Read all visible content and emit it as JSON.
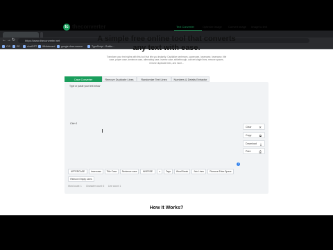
{
  "browser": {
    "url": "https://www.theconverter.net",
    "bookmarks": [
      "CIS",
      "EE",
      "chatGPT",
      "Whiteboard",
      "google docs source",
      "TypeScript - Builde..."
    ]
  },
  "site": {
    "logo_text": "theconverter",
    "logo_letter": "tc",
    "nav": [
      "Text Converter",
      "Optimize image",
      "Convert image",
      "Image to text"
    ],
    "hero_title": "A simple free online tool that converts any text with ease.",
    "description": "Transform your text styles with this tool that lets you instantly: Capitalize sentences, uppercase, lowercase, lowercase, title case, proper case, sentence case, alternating case, inverse case, strikethrough, convert single lines, remove spaces, remove duplicate lines, and more..."
  },
  "tool_tabs": [
    "Case Converter",
    "Remove Duplicate Lines",
    "Randomize Text Lines",
    "Numbers & Details Extractor"
  ],
  "editor": {
    "label": "Type or paste your text below",
    "content": "Ctrl+J"
  },
  "side_buttons": [
    {
      "label": "Clear",
      "icon": "✕"
    },
    {
      "label": "Copy",
      "icon": "⧉"
    },
    {
      "label": "Download",
      "icon": "⤓"
    },
    {
      "label": "Print",
      "icon": "⎙"
    }
  ],
  "case_buttons_row1": [
    "UPPERCASE",
    "lowercase",
    "Title Case",
    "Sentence case",
    "iNVERSE",
    "Tags",
    "Word Break",
    "Join Lines",
    "Remove Extra Space"
  ],
  "case_buttons_row2": [
    "Remove Empty Lines"
  ],
  "footer_links": [
    "Word count: 1",
    "Character count: 6",
    "Line count: 1"
  ],
  "section_title": "How It Works?",
  "colors": {
    "brand": "#1a9e5c",
    "info": "#2f80ed"
  }
}
